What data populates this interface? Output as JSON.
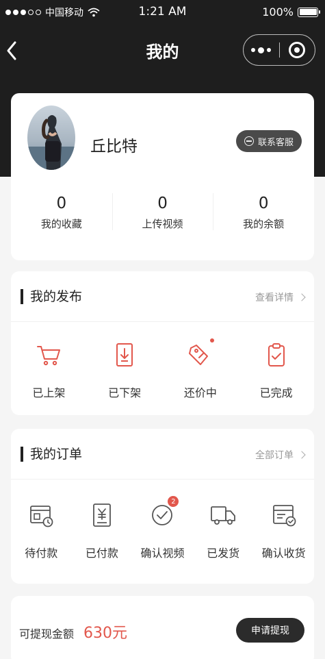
{
  "status_bar": {
    "carrier": "中国移动",
    "time": "1:21 AM",
    "battery": "100%"
  },
  "nav": {
    "title": "我的"
  },
  "profile": {
    "username": "丘比特",
    "customer_service_label": "联系客服",
    "stats": [
      {
        "value": "0",
        "label": "我的收藏"
      },
      {
        "value": "0",
        "label": "上传视频"
      },
      {
        "value": "0",
        "label": "我的余额"
      }
    ]
  },
  "publish": {
    "title": "我的发布",
    "link": "查看详情",
    "items": [
      {
        "label": "已上架",
        "icon": "cart-icon"
      },
      {
        "label": "已下架",
        "icon": "download-box-icon"
      },
      {
        "label": "还价中",
        "icon": "price-tag-icon"
      },
      {
        "label": "已完成",
        "icon": "clipboard-check-icon"
      }
    ]
  },
  "orders": {
    "title": "我的订单",
    "link": "全部订单",
    "items": [
      {
        "label": "待付款",
        "icon": "wallet-clock-icon"
      },
      {
        "label": "已付款",
        "icon": "yen-receipt-icon"
      },
      {
        "label": "确认视频",
        "icon": "check-circle-icon",
        "badge": "2"
      },
      {
        "label": "已发货",
        "icon": "truck-icon"
      },
      {
        "label": "确认收货",
        "icon": "receipt-check-icon"
      }
    ]
  },
  "balance": {
    "label": "可提现金额",
    "amount": "630元",
    "button": "申请提现"
  },
  "colors": {
    "accent_red": "#e2574c",
    "header_dark": "#1e1e1e"
  }
}
